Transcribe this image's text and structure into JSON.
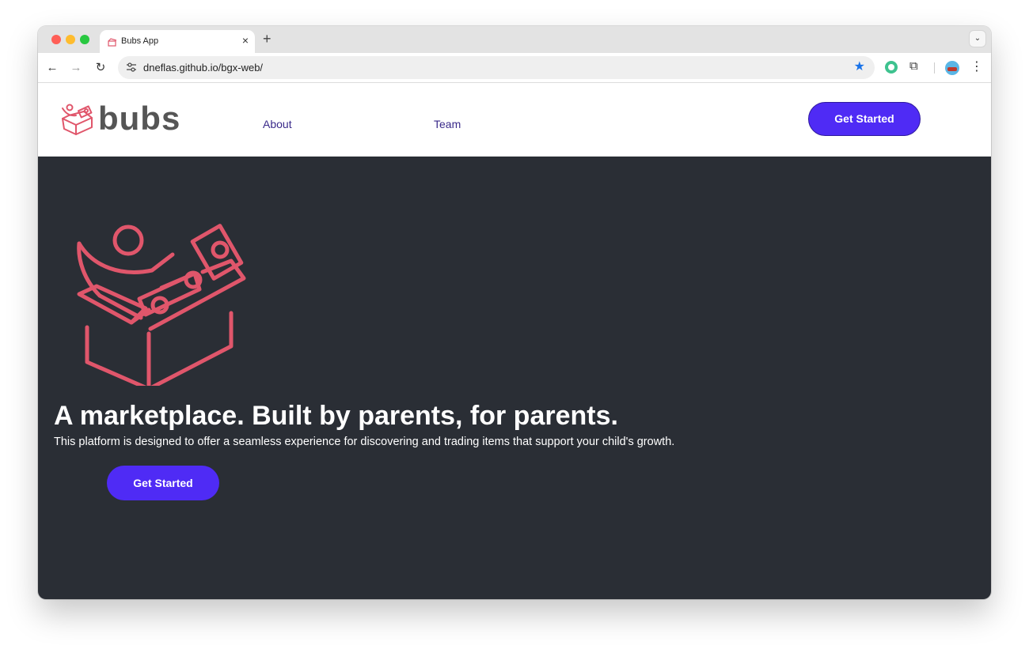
{
  "browser": {
    "tab_title": "Bubs App",
    "tab_close": "×",
    "new_tab": "+",
    "tab_menu": "⌄",
    "url": "dneflas.github.io/bgx-web/",
    "back": "←",
    "forward": "→",
    "reload": "↻",
    "star": "★",
    "extensions": "⧉",
    "menu": "⋮"
  },
  "header": {
    "logo_text": "bubs",
    "nav": [
      {
        "label": "About"
      },
      {
        "label": "Team"
      }
    ],
    "cta_label": "Get Started"
  },
  "hero": {
    "title": "A marketplace. Built by parents, for parents.",
    "subtitle": "This platform is designed to offer a seamless experience for discovering and trading items that support your child's growth.",
    "cta_label": "Get Started"
  },
  "colors": {
    "accent": "#4f2bf5",
    "brand_pink": "#e0566b",
    "hero_bg": "#2a2e35",
    "nav_link": "#3a2a8a"
  }
}
